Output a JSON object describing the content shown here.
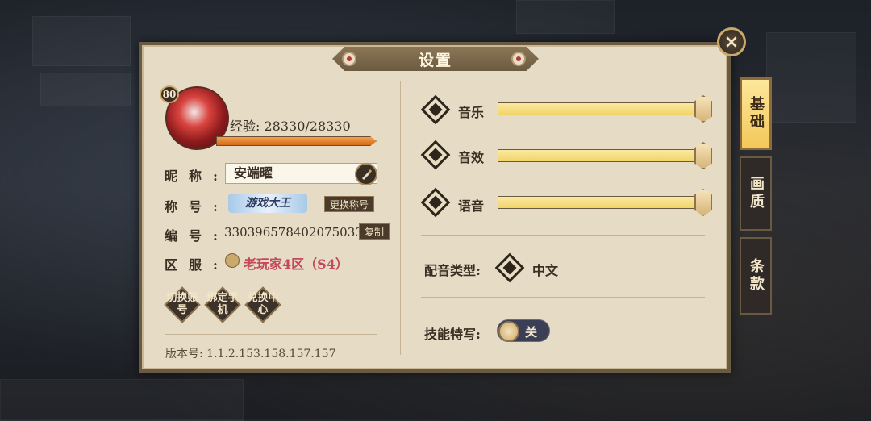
{
  "window": {
    "title": "设置",
    "close_icon": "×"
  },
  "profile": {
    "level": "80",
    "exp_text": "经验: 28330/28330",
    "exp_progress": 1.0,
    "nickname_label": "昵称:",
    "nickname_value": "安端曜",
    "title_label": "称号:",
    "title_value": "游戏大王",
    "change_title_button": "更换称号",
    "id_label": "编号:",
    "id_value": "3303965784020750337",
    "copy_button": "复制",
    "server_label": "区服:",
    "server_value": "老玩家4区（S4）"
  },
  "actions": [
    {
      "label": "切换账号"
    },
    {
      "label": "绑定手机"
    },
    {
      "label": "兑换中心"
    }
  ],
  "version_text": "版本号: 1.1.2.153.158.157.157",
  "audio": [
    {
      "label": "音乐",
      "level": 1.0
    },
    {
      "label": "音效",
      "level": 1.0
    },
    {
      "label": "语音",
      "level": 1.0
    }
  ],
  "voice": {
    "label": "配音类型:",
    "value": "中文"
  },
  "skill_closeup": {
    "label": "技能特写:",
    "toggle_text": "关",
    "enabled": false
  },
  "side_tabs": [
    {
      "label": "基础",
      "active": true
    },
    {
      "label": "画质",
      "active": false
    },
    {
      "label": "条款",
      "active": false
    }
  ],
  "colors": {
    "accent": "#f1d46a",
    "panel": "#e6dcc6",
    "server_text": "#c2485a"
  }
}
